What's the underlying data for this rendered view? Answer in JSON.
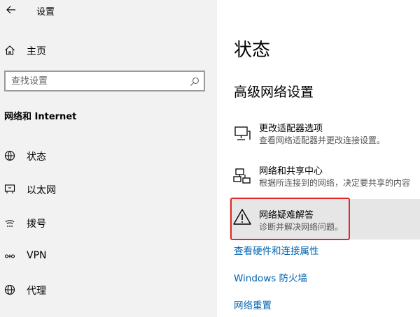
{
  "window": {
    "title": "设置"
  },
  "sidebar": {
    "home_label": "主页",
    "search_placeholder": "查找设置",
    "section_title": "网络和 Internet",
    "items": [
      {
        "label": "状态",
        "icon": "home-status-icon"
      },
      {
        "label": "以太网",
        "icon": "ethernet-icon"
      },
      {
        "label": "拨号",
        "icon": "dialup-icon"
      },
      {
        "label": "VPN",
        "icon": "vpn-icon"
      },
      {
        "label": "代理",
        "icon": "globe-icon"
      }
    ]
  },
  "main": {
    "title": "状态",
    "subtitle": "高级网络设置",
    "options": [
      {
        "title": "更改适配器选项",
        "desc": "查看网络适配器并更改连接设置。",
        "icon": "adapter-icon"
      },
      {
        "title": "网络和共享中心",
        "desc": "根据所连接到的网络，决定要共享的内容",
        "icon": "sharing-center-icon"
      },
      {
        "title": "网络疑难解答",
        "desc": "诊断并解决网络问题。",
        "icon": "warning-icon"
      }
    ],
    "links": [
      {
        "label": "查看硬件和连接属性"
      },
      {
        "label": "Windows 防火墙"
      },
      {
        "label": "网络重置"
      }
    ]
  },
  "colors": {
    "accent_link": "#0063b1",
    "highlight_border": "#e32626",
    "sidebar_bg": "#f2f2f2"
  }
}
